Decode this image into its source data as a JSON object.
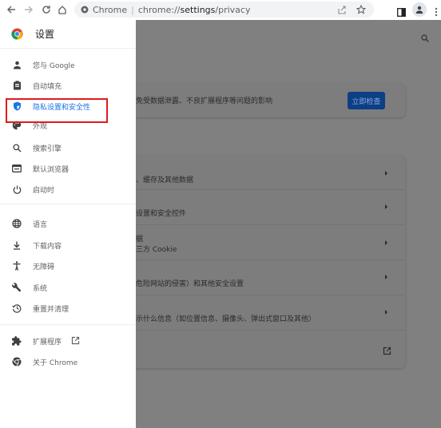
{
  "browser": {
    "omnibox": {
      "site_label": "Chrome",
      "url_prefix": "chrome://",
      "url_host": "settings",
      "url_path": "/privacy"
    }
  },
  "sidebar": {
    "title": "设置",
    "items": [
      {
        "label": "您与 Google",
        "icon": "person-icon"
      },
      {
        "label": "自动填充",
        "icon": "clipboard-icon"
      },
      {
        "label": "隐私设置和安全性",
        "icon": "shield-icon",
        "active": true
      },
      {
        "label": "外观",
        "icon": "palette-icon"
      },
      {
        "label": "搜索引擎",
        "icon": "search-icon"
      },
      {
        "label": "默认浏览器",
        "icon": "browser-icon"
      },
      {
        "label": "启动时",
        "icon": "power-icon"
      },
      {
        "label": "语言",
        "icon": "globe-icon"
      },
      {
        "label": "下载内容",
        "icon": "download-icon"
      },
      {
        "label": "无障碍",
        "icon": "accessibility-icon"
      },
      {
        "label": "系统",
        "icon": "wrench-icon"
      },
      {
        "label": "重置并清理",
        "icon": "history-icon"
      },
      {
        "label": "扩展程序",
        "icon": "puzzle-icon"
      },
      {
        "label": "关于 Chrome",
        "icon": "chrome-icon"
      }
    ]
  },
  "main": {
    "safety_check": {
      "text": "免受数据泄露、不良扩展程序等问题的影响",
      "button_label": "立即检查"
    },
    "rows": [
      {
        "line1": "",
        "line2": "、缓存及其他数据"
      },
      {
        "line1": "",
        "line2": "设置和安全控件"
      },
      {
        "line1": "据",
        "line2": "三方 Cookie"
      },
      {
        "line1": "",
        "line2": "危险网站的侵害）和其他安全设置"
      },
      {
        "line1": "",
        "line2": "示什么信息（如位置信息、摄像头、弹出式窗口及其他）"
      }
    ]
  },
  "colors": {
    "accent": "#1a73e8",
    "highlight_border": "#e01b1b",
    "overlay": "#808080",
    "button": "#0b3f86"
  }
}
